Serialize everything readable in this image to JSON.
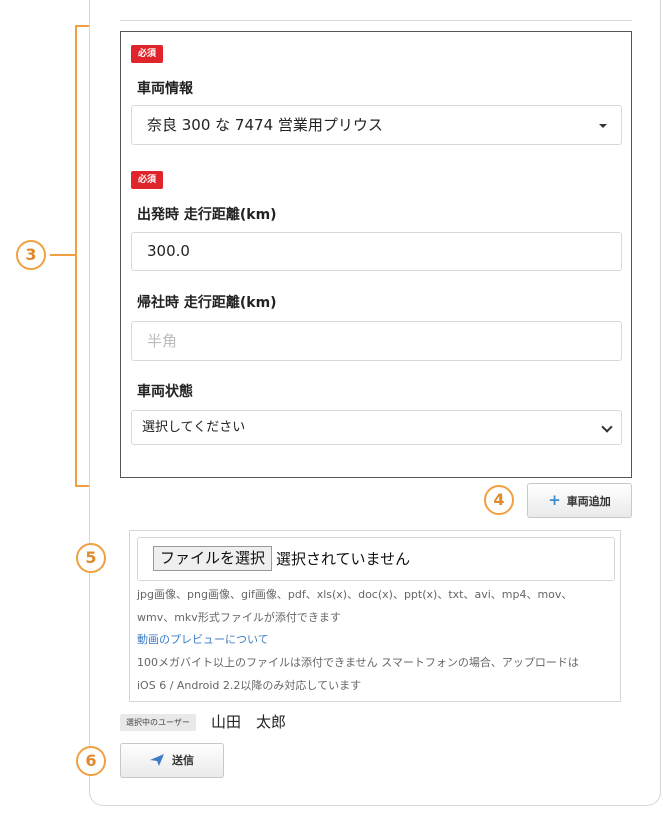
{
  "vehicle": {
    "required_badge": "必須",
    "vehicle_info_label": "車両情報",
    "vehicle_select_value": "奈良 300 な 7474 営業用プリウス",
    "departure_required_badge": "必須",
    "departure_label": "出発時 走行距離(km)",
    "departure_value": "300.0",
    "return_label": "帰社時 走行距離(km)",
    "return_placeholder": "半角",
    "status_label": "車両状態",
    "status_value": "選択してください"
  },
  "add_vehicle": {
    "icon": "plus-icon",
    "label": "車両追加"
  },
  "attachment": {
    "choose_button": "ファイルを選択",
    "no_file_text": "選択されていません",
    "note_line1": "jpg画像、png画像、gif画像、pdf、xls(x)、doc(x)、ppt(x)、txt、avi、mp4、mov、",
    "note_line2": "wmv、mkv形式ファイルが添付できます",
    "preview_link": "動画のプレビューについて",
    "note_line3": "100メガバイト以上のファイルは添付できません スマートフォンの場合、アップロードは",
    "note_line4": "iOS 6 / Android 2.2以降のみ対応しています"
  },
  "user": {
    "badge": "選択中のユーザー",
    "name": "山田　太郎"
  },
  "submit": {
    "icon": "send-icon",
    "label": "送信"
  },
  "callouts": {
    "c3": "3",
    "c4": "4",
    "c5": "5",
    "c6": "6"
  },
  "colors": {
    "accent": "#f0a040",
    "required": "#e0242c",
    "link": "#3b7ec6",
    "plus": "#3b8bd0"
  }
}
